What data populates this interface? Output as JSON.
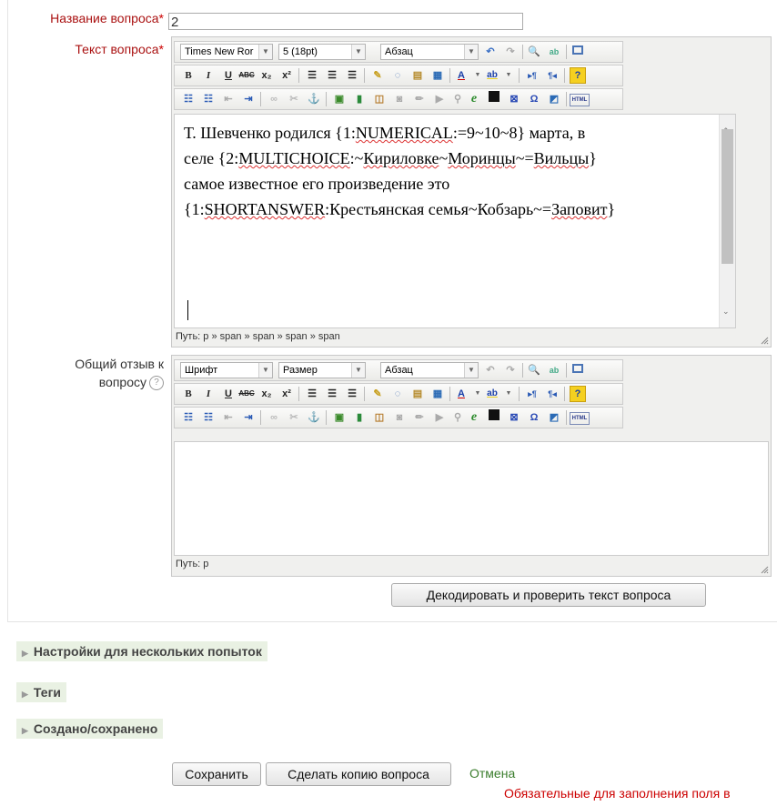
{
  "question_name": {
    "label": "Название вопроса",
    "required_mark": "*",
    "value": "2"
  },
  "question_text": {
    "label": "Текст вопроса",
    "required_mark": "*",
    "font_select": "Times New Ror",
    "size_select": "5 (18pt)",
    "format_select": "Абзац",
    "lines": [
      {
        "parts": [
          "Т. Шевченко родился  {1:",
          "NUMERICAL",
          ":=9~10~8} марта, в"
        ]
      },
      {
        "parts": [
          "селе {2:",
          "MULTICHOICE",
          ":~",
          "Кириловке",
          "~",
          "Моринцы",
          "~=",
          "Вильцы",
          "}"
        ]
      },
      {
        "parts": [
          "самое известное его произведение это"
        ]
      },
      {
        "parts": [
          "{1:",
          "SHORTANSWER",
          ":Крестьянская семья~Кобзарь~=",
          "Заповит",
          "}"
        ]
      }
    ],
    "path": "Путь: p » span » span » span » span"
  },
  "general_feedback": {
    "label_line1": "Общий отзыв к",
    "label_line2": "вопросу",
    "font_select": "Шрифт",
    "size_select": "Размер",
    "format_select": "Абзац",
    "path": "Путь: p"
  },
  "decode_button": "Декодировать и проверить текст вопроса",
  "sections": [
    "Настройки для нескольких попыток",
    "Теги",
    "Создано/сохранено"
  ],
  "save_button": "Сохранить",
  "copy_button": "Сделать копию вопроса",
  "cancel_link": "Отмена",
  "required_note": "Обязательные для заполнения поля в",
  "toolbar_icons": {
    "bold": "B",
    "italic": "I",
    "underline": "U",
    "strike": "ABC",
    "sub": "x₂",
    "sup": "x²",
    "help": "?",
    "html": "HTML",
    "omega": "Ω"
  },
  "colors": {
    "required": "#c00",
    "section_bg": "#e9f1e3",
    "cancel": "#3a7d2c"
  }
}
